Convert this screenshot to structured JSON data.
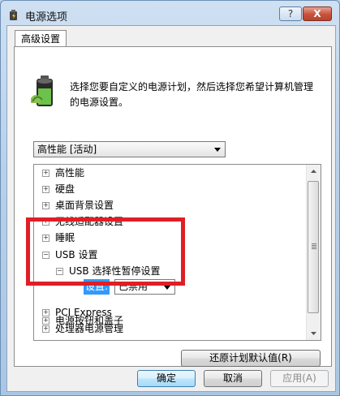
{
  "window": {
    "title": "电源选项",
    "help_label": "?",
    "close_label": "X"
  },
  "tab": {
    "label": "高级设置"
  },
  "intro": {
    "text": "选择您要自定义的电源计划，然后选择您希望计算机管理的电源设置。"
  },
  "plan_select": {
    "value": "高性能 [活动]"
  },
  "tree": {
    "items": [
      {
        "label": "高性能",
        "expander": "+"
      },
      {
        "label": "硬盘",
        "expander": "+"
      },
      {
        "label": "桌面背景设置",
        "expander": "+"
      },
      {
        "label": "无线适配器设置",
        "expander": "+"
      },
      {
        "label": "睡眠",
        "expander": "+"
      },
      {
        "label": "USB 设置",
        "expander": "−"
      },
      {
        "label": "USB 选择性暂停设置",
        "expander": "−"
      },
      {
        "label": "电源按钮和盖子",
        "expander": "+"
      },
      {
        "label": "PCI Express",
        "expander": "+"
      },
      {
        "label": "处理器电源管理",
        "expander": "+"
      }
    ],
    "setting": {
      "label": "设置:",
      "value": "已禁用"
    }
  },
  "buttons": {
    "restore": "还原计划默认值(R)",
    "ok": "确定",
    "cancel": "取消",
    "apply": "应用(A)"
  },
  "colors": {
    "highlight_border": "#e01e25",
    "selection": "#3399ff"
  }
}
